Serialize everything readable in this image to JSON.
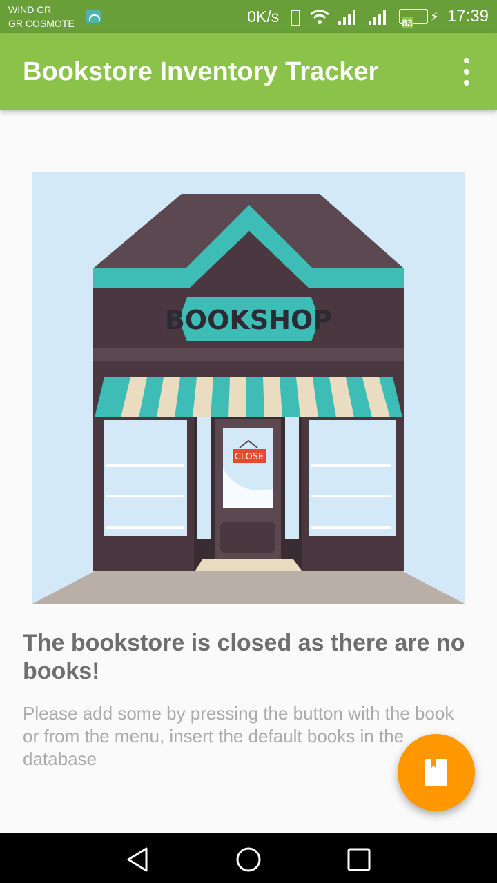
{
  "status_bar": {
    "carrier_1": "WIND GR",
    "carrier_2": "GR COSMOTE",
    "network_speed": "0K/s",
    "battery_level": "83",
    "time": "17:39",
    "icons": [
      "android-notification-icon",
      "vibrate-icon",
      "wifi-icon",
      "signal-icon",
      "signal-icon",
      "battery-icon",
      "charging-icon"
    ]
  },
  "app_bar": {
    "title": "Bookstore Inventory Tracker",
    "menu_icon": "more-vert-icon",
    "color": "#8bc34a"
  },
  "illustration": {
    "sign_text": "BOOKSHOP",
    "door_sign_text": "CLOSE"
  },
  "empty_state": {
    "title": "The bookstore is closed as there are no books!",
    "description": "Please add some by pressing the button with the book or from the menu, insert the default books in the database"
  },
  "fab": {
    "icon": "book-icon",
    "color": "#ff9800"
  },
  "nav_bar": {
    "buttons": [
      "back-icon",
      "home-icon",
      "recents-icon"
    ]
  }
}
